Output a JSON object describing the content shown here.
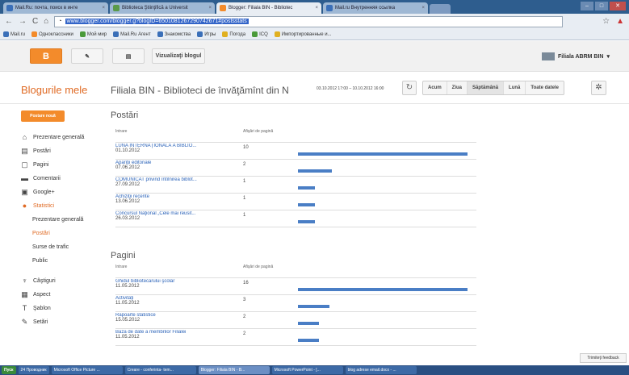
{
  "browser": {
    "tabs": [
      {
        "label": "Mail.Ru: почта, поиск в инте",
        "color": "#3a6fb8"
      },
      {
        "label": "Biblioteca Ştiinţifică a Universit",
        "color": "#5a9a4a"
      },
      {
        "label": "Blogger: Filiala BIN - Bibliotec",
        "color": "#f38b2b"
      },
      {
        "label": "Mail.ru Внутренняя ссылка",
        "color": "#3a6fb8"
      }
    ],
    "url_host": "www.blogger.com/blogger.g?blogID=6501081267290742671#postsstats",
    "bookmarks": [
      "Mail.ru",
      "Одноклассники",
      "Мой мир",
      "Mail.Ru Агент",
      "Знакомства",
      "Игры",
      "Погода",
      "ICQ",
      "Импортированные и..."
    ]
  },
  "blogger_bar": {
    "view_blog": "Vizualizaţi blogul",
    "user": "Filiala ABRM BIN"
  },
  "header": {
    "my_blogs": "Blogurile mele",
    "blog_title": "Filiala BIN - Biblioteci de învăţămînt din N",
    "date_range": "03.10.2012 17:00 – 10.10.2012 16:00",
    "periods": [
      "Acum",
      "Ziua",
      "Săptămână",
      "Lună",
      "Toate datele"
    ],
    "selected_period": "Săptămână"
  },
  "sidebar": {
    "new_post": "Postare nouă",
    "items": [
      {
        "label": "Prezentare generală",
        "icon": "home-icon",
        "glyph": "⌂"
      },
      {
        "label": "Postări",
        "icon": "posts-icon",
        "glyph": "▤"
      },
      {
        "label": "Pagini",
        "icon": "pages-icon",
        "glyph": "▢"
      },
      {
        "label": "Comentarii",
        "icon": "comments-icon",
        "glyph": "▬"
      },
      {
        "label": "Google+",
        "icon": "google-plus-icon",
        "glyph": "▣"
      },
      {
        "label": "Statistici",
        "icon": "stats-icon",
        "glyph": "●"
      }
    ],
    "stats_sub": [
      "Prezentare generală",
      "Postări",
      "Surse de trafic",
      "Public"
    ],
    "bottom": [
      {
        "label": "Câştiguri",
        "icon": "earnings-icon",
        "glyph": "♆"
      },
      {
        "label": "Aspect",
        "icon": "layout-icon",
        "glyph": "▦"
      },
      {
        "label": "Şablon",
        "icon": "template-icon",
        "glyph": "T"
      },
      {
        "label": "Setări",
        "icon": "settings-icon",
        "glyph": "✎"
      }
    ]
  },
  "posts": {
    "title": "Postări",
    "col_entry": "Intrare",
    "col_views": "Afişări de pagină",
    "rows": [
      {
        "title": "LUNA INTERNAŢIONALĂ A BIBLIO...",
        "date": "01.10.2012",
        "views": "10",
        "bar": 1.0
      },
      {
        "title": "Apariţii editoriale",
        "date": "07.06.2012",
        "views": "2",
        "bar": 0.2
      },
      {
        "title": "COMUNICAT privind întîlnirea biblot...",
        "date": "27.09.2012",
        "views": "1",
        "bar": 0.1
      },
      {
        "title": "Achiziţii recente",
        "date": "13.06.2012",
        "views": "1",
        "bar": 0.1
      },
      {
        "title": "Concursul Naţional „Cele mai reusit...",
        "date": "26.03.2012",
        "views": "1",
        "bar": 0.1
      }
    ]
  },
  "pages": {
    "title": "Pagini",
    "col_entry": "Intrare",
    "col_views": "Afişări de pagină",
    "rows": [
      {
        "title": "Ghidul bibliotecarului şcolar",
        "date": "11.05.2012",
        "views": "16",
        "bar": 1.0
      },
      {
        "title": "Activităţi",
        "date": "11.05.2012",
        "views": "3",
        "bar": 0.1875
      },
      {
        "title": "Rapoarte statistice",
        "date": "15.05.2012",
        "views": "2",
        "bar": 0.125
      },
      {
        "title": "Baza de date a membrilor Filialei",
        "date": "11.05.2012",
        "views": "2",
        "bar": 0.125
      }
    ]
  },
  "feedback": "Trimiteţi feedback",
  "taskbar": [
    "Пуск",
    "24 Проводник",
    "Microsoft Office Picture ...",
    "Creare - conferinta- tem...",
    "Blogger: Filiala BIN - B...",
    "Microsoft PowerPoint - [...",
    "blog adrese email.docx - ..."
  ]
}
